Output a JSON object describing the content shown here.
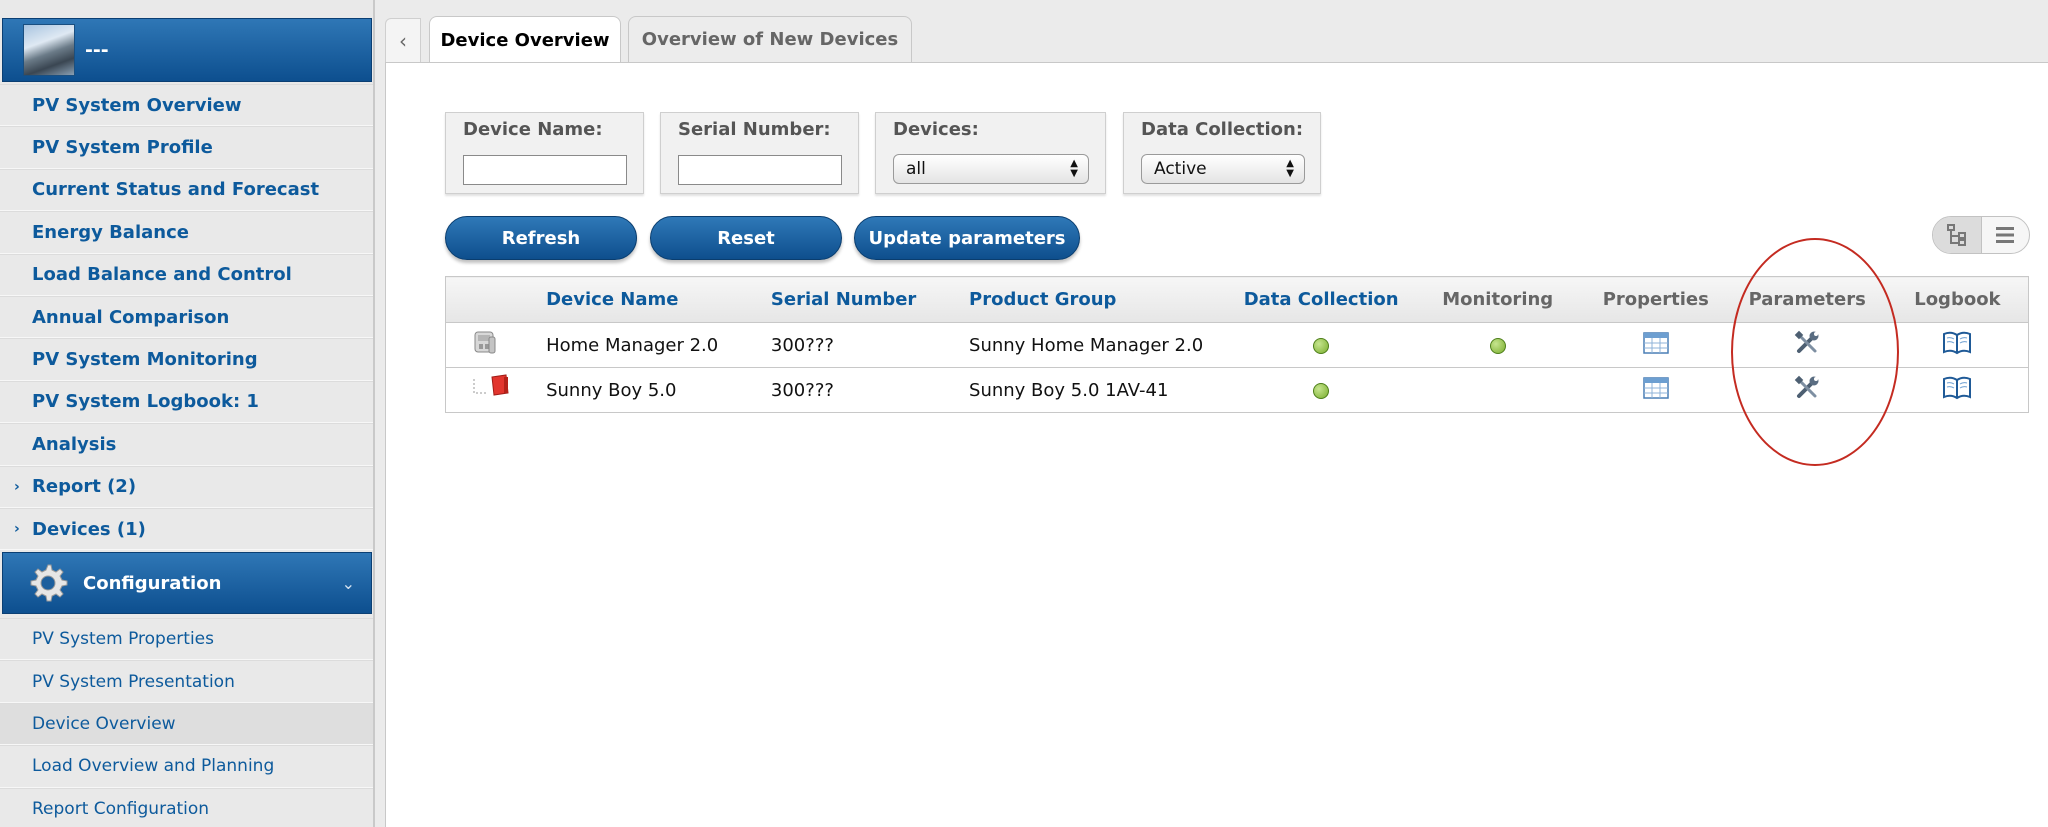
{
  "sidebar": {
    "header_title": "---",
    "items": [
      {
        "label": "PV System Overview"
      },
      {
        "label": "PV System Profile"
      },
      {
        "label": "Current Status and Forecast"
      },
      {
        "label": "Energy Balance"
      },
      {
        "label": "Load Balance and Control"
      },
      {
        "label": "Annual Comparison"
      },
      {
        "label": "PV System Monitoring"
      },
      {
        "label": "PV System Logbook: 1"
      },
      {
        "label": "Analysis"
      },
      {
        "label": "Report (2)"
      },
      {
        "label": "Devices (1)"
      }
    ],
    "config": {
      "title": "Configuration",
      "items": [
        {
          "label": "PV System Properties"
        },
        {
          "label": "PV System Presentation"
        },
        {
          "label": "Device Overview",
          "active": true
        },
        {
          "label": "Load Overview and Planning"
        },
        {
          "label": "Report Configuration"
        }
      ]
    }
  },
  "tabs": [
    {
      "label": "Device Overview",
      "active": true
    },
    {
      "label": "Overview of New Devices",
      "active": false
    }
  ],
  "filters": {
    "device_name": {
      "label": "Device Name:",
      "value": ""
    },
    "serial_number": {
      "label": "Serial Number:",
      "value": ""
    },
    "devices": {
      "label": "Devices:",
      "selected": "all"
    },
    "data_collection": {
      "label": "Data Collection:",
      "selected": "Active"
    }
  },
  "buttons": {
    "refresh": "Refresh",
    "reset": "Reset",
    "update_parameters": "Update parameters"
  },
  "table": {
    "columns": [
      "Device Name",
      "Serial Number",
      "Product Group",
      "Data Collection",
      "Monitoring",
      "Properties",
      "Parameters",
      "Logbook"
    ],
    "rows": [
      {
        "device_name": "Home Manager 2.0",
        "serial_number": "300???",
        "product_group": "Sunny Home Manager 2.0",
        "data_collection": "active",
        "monitoring": "active",
        "icon": "home-manager-device-icon"
      },
      {
        "device_name": "Sunny Boy 5.0",
        "serial_number": "300???",
        "product_group": "Sunny Boy 5.0 1AV-41",
        "data_collection": "active",
        "monitoring": "none",
        "icon": "inverter-device-icon"
      }
    ]
  },
  "colors": {
    "nav_blue": "#0d5a9c",
    "header_blue": "#0d4f8f",
    "status_green": "#8cc04a",
    "annotation_red": "#c42b21"
  }
}
